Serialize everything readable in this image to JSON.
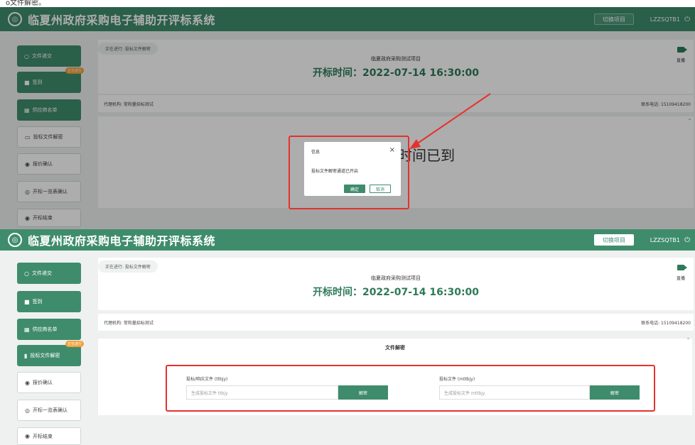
{
  "doc_line": "o文件解密。",
  "app": {
    "title": "临夏州政府采购电子辅助开评标系统",
    "switch_project": "切换项目",
    "user": "LZZSQTB1"
  },
  "sidebar": {
    "top": [
      {
        "label": "文件递交",
        "icon": "circle-icon",
        "style": "active"
      },
      {
        "label": "签到",
        "icon": "square-icon",
        "style": "active",
        "badge": "正在进行"
      },
      {
        "label": "供应商名单",
        "icon": "list-icon",
        "style": "active"
      },
      {
        "label": "投标文件解密",
        "icon": "file-icon",
        "style": "outline"
      },
      {
        "label": "报价确认",
        "icon": "radio-icon",
        "style": "outline"
      },
      {
        "label": "开标一览表确认",
        "icon": "check-circle-icon",
        "style": "outline"
      },
      {
        "label": "开标结束",
        "icon": "radio-icon",
        "style": "outline"
      }
    ],
    "bottom": [
      {
        "label": "文件递交",
        "icon": "circle-icon",
        "style": "active"
      },
      {
        "label": "签到",
        "icon": "square-icon",
        "style": "active"
      },
      {
        "label": "供应商名单",
        "icon": "list-icon",
        "style": "active"
      },
      {
        "label": "投标文件解密",
        "icon": "file-icon",
        "style": "active",
        "badge": "正在进行"
      },
      {
        "label": "报价确认",
        "icon": "radio-icon",
        "style": "outline"
      },
      {
        "label": "开标一览表确认",
        "icon": "check-circle-icon",
        "style": "outline"
      },
      {
        "label": "开标结束",
        "icon": "radio-icon",
        "style": "outline"
      }
    ]
  },
  "info": {
    "progress": "正在进行: 投标文件解密",
    "project_name": "临夏政府采购测试项目",
    "bid_time": "开标时间：2022-07-14 16:30:00",
    "live_label": "直播",
    "agency": "代理机构: 常和量招标测试",
    "contact": "联系电话: 15109418200"
  },
  "background_text": "时间已到",
  "dialog": {
    "title": "信息",
    "close": "×",
    "message": "投标文件解密通道已开启",
    "ok": "确定",
    "cancel": "取消"
  },
  "decrypt": {
    "title": "文件解密",
    "left_label": "投标/响应文件 (ttbjy)",
    "left_placeholder": "生成投标文件 ttbjy",
    "right_label": "投标文件 (mttbjy)",
    "right_placeholder": "生成投标文件 mttbjy",
    "button": "解密"
  },
  "colors": {
    "primary": "#3f8c6c",
    "badge": "#f0a13a",
    "highlight": "#e5322d"
  }
}
